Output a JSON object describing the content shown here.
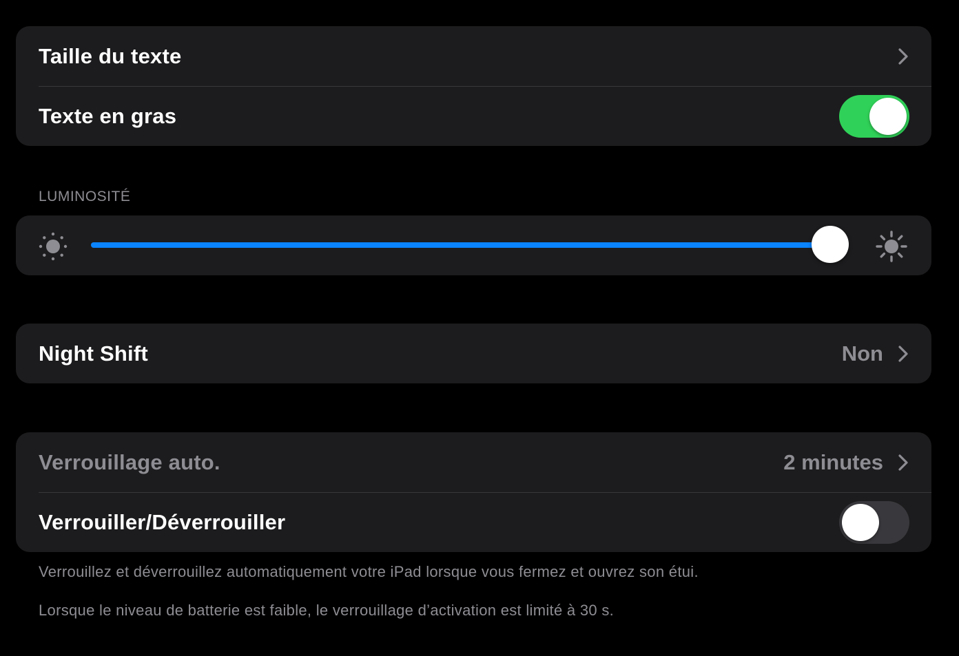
{
  "text_group": {
    "text_size_label": "Taille du texte",
    "bold_text_label": "Texte en gras",
    "bold_text_on": true
  },
  "brightness": {
    "header": "LUMINOSITÉ",
    "level": 0.99,
    "accent_color": "#0a84ff"
  },
  "night_shift": {
    "label": "Night Shift",
    "value": "Non"
  },
  "lock_group": {
    "auto_lock_label": "Verrouillage auto.",
    "auto_lock_value": "2 minutes",
    "lock_unlock_label": "Verrouiller/Déverrouiller",
    "lock_unlock_on": false
  },
  "footnotes": {
    "line1": "Verrouillez et déverrouillez automatiquement votre iPad lorsque vous fermez et ouvrez son étui.",
    "line2": "Lorsque le niveau de batterie est faible, le verrouillage d’activation est limité à 30 s."
  },
  "icons": {
    "chevron": "chevron-right-icon",
    "sun_small": "sun-min-icon",
    "sun_large": "sun-max-icon"
  },
  "colors": {
    "toggle_on": "#30d158",
    "toggle_off": "#39393d",
    "cell_background": "#1c1c1e",
    "secondary_text": "#8d8d93"
  }
}
